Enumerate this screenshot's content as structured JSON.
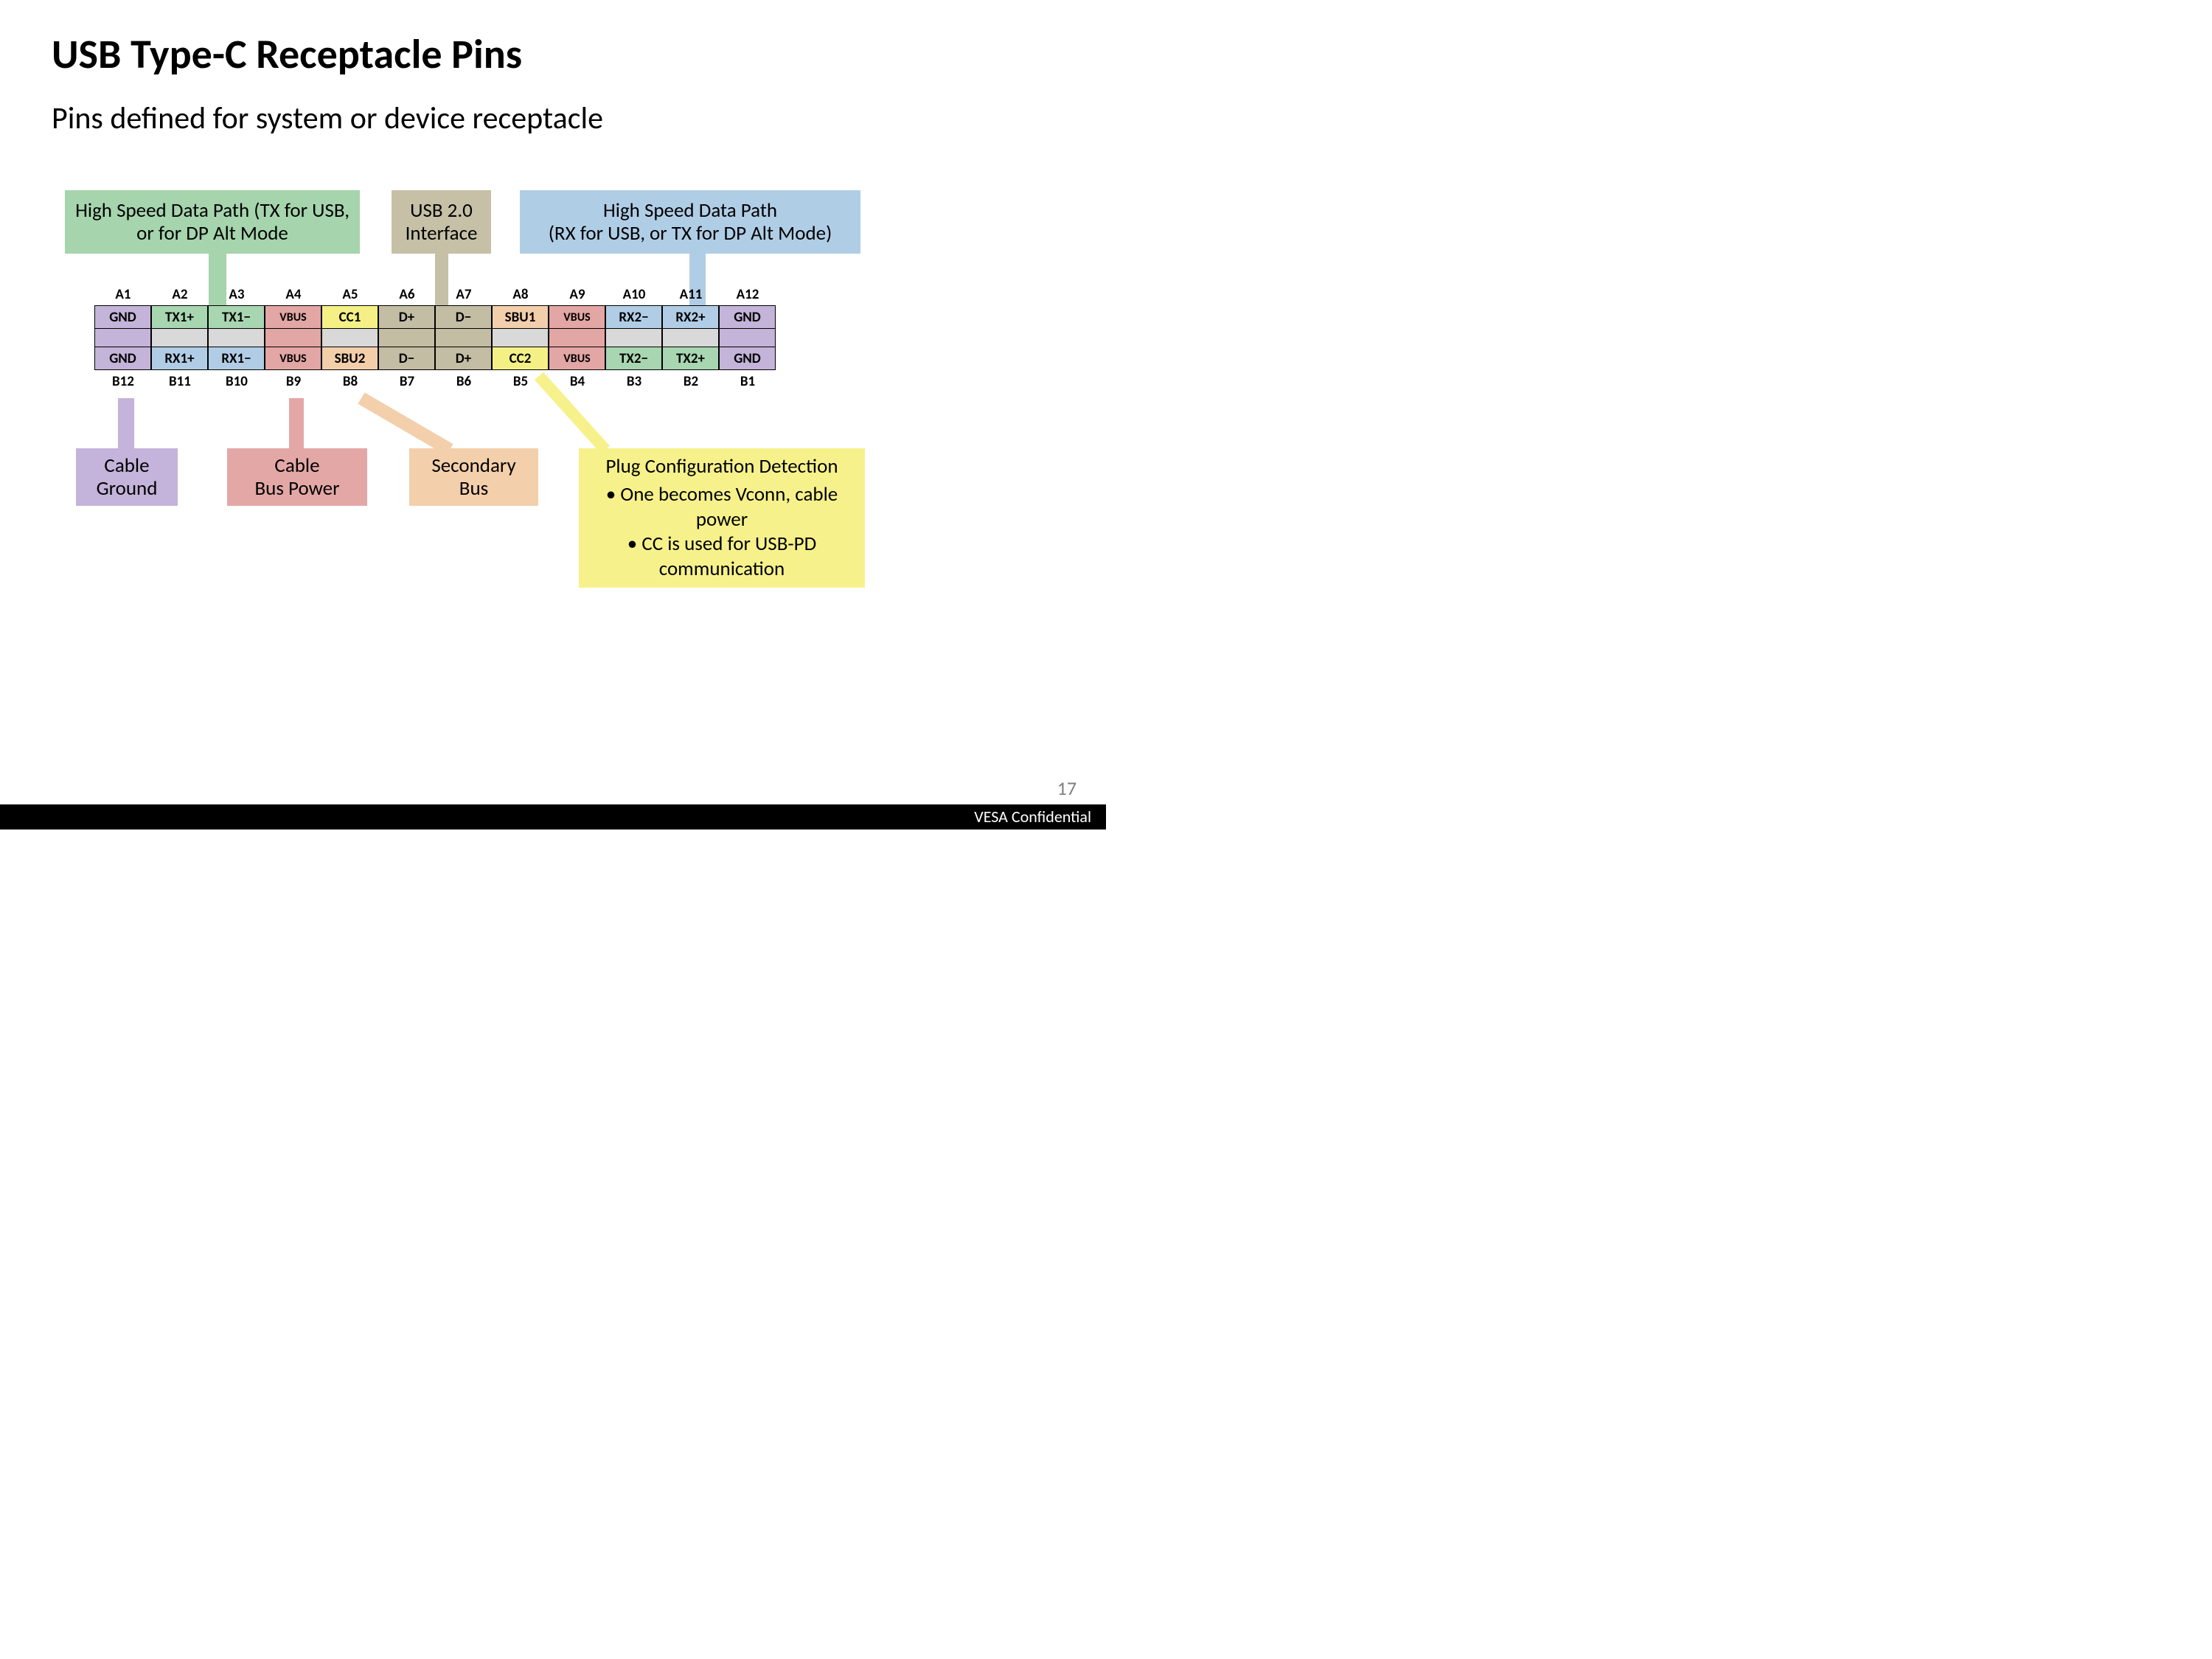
{
  "title": "USB Type-C Receptacle Pins",
  "subtitle": "Pins defined for system or device receptacle",
  "pageNumber": "17",
  "watermark": "VESA Confidential",
  "colors": {
    "gnd": "#c4b4d9",
    "txgreen": "#a8d6b1",
    "vbus": "#e2a6a4",
    "cc": "#f4f086",
    "usb2": "#c2bda3",
    "sbu": "#f2ceab",
    "rxblue": "#b1cde6",
    "midGrey": "#d9d9d9",
    "calloutGreen": "#a5d4ad",
    "calloutTan": "#c5c0a6",
    "calloutBlue": "#b0cde6",
    "calloutPurple": "#c4b3da",
    "calloutRed": "#e3a8a6",
    "calloutOrange": "#f3cfab",
    "calloutYellow": "#f6f18b"
  },
  "callouts": {
    "hsTx": "High Speed Data Path (TX for USB, or for DP Alt Mode",
    "usb2": "USB 2.0 Interface",
    "hsRx": "High Speed Data Path\n(RX for USB, or TX for DP Alt Mode)",
    "cableGround": "Cable Ground",
    "cableBusPower": "Cable\nBus Power",
    "secondaryBus": "Secondary Bus",
    "plugTitle": "Plug Configuration Detection",
    "plugBullet1": "One becomes Vconn, cable power",
    "plugBullet2": "CC is used for USB-PD communication"
  },
  "labelsTop": [
    "A1",
    "A2",
    "A3",
    "A4",
    "A5",
    "A6",
    "A7",
    "A8",
    "A9",
    "A10",
    "A11",
    "A12"
  ],
  "labelsBottom": [
    "B12",
    "B11",
    "B10",
    "B9",
    "B8",
    "B7",
    "B6",
    "B5",
    "B4",
    "B3",
    "B2",
    "B1"
  ],
  "rowA": [
    {
      "text": "GND",
      "c": "gnd"
    },
    {
      "text": "TX1+",
      "c": "txgreen"
    },
    {
      "text": "TX1−",
      "c": "txgreen"
    },
    {
      "text": "VBUS",
      "c": "vbus",
      "small": true
    },
    {
      "text": "CC1",
      "c": "cc"
    },
    {
      "text": "D+",
      "c": "usb2"
    },
    {
      "text": "D−",
      "c": "usb2"
    },
    {
      "text": "SBU1",
      "c": "sbu"
    },
    {
      "text": "VBUS",
      "c": "vbus",
      "small": true
    },
    {
      "text": "RX2−",
      "c": "rxblue"
    },
    {
      "text": "RX2+",
      "c": "rxblue"
    },
    {
      "text": "GND",
      "c": "gnd"
    }
  ],
  "rowB": [
    {
      "text": "GND",
      "c": "gnd"
    },
    {
      "text": "RX1+",
      "c": "rxblue"
    },
    {
      "text": "RX1−",
      "c": "rxblue"
    },
    {
      "text": "VBUS",
      "c": "vbus",
      "small": true
    },
    {
      "text": "SBU2",
      "c": "sbu"
    },
    {
      "text": "D−",
      "c": "usb2"
    },
    {
      "text": "D+",
      "c": "usb2"
    },
    {
      "text": "CC2",
      "c": "cc"
    },
    {
      "text": "VBUS",
      "c": "vbus",
      "small": true
    },
    {
      "text": "TX2−",
      "c": "txgreen"
    },
    {
      "text": "TX2+",
      "c": "txgreen"
    },
    {
      "text": "GND",
      "c": "gnd"
    }
  ],
  "midRow": [
    {
      "c": "gnd"
    },
    {
      "c": "midGrey"
    },
    {
      "c": "midGrey"
    },
    {
      "c": "vbus"
    },
    {
      "c": "midGrey"
    },
    {
      "c": "usb2"
    },
    {
      "c": "usb2"
    },
    {
      "c": "midGrey"
    },
    {
      "c": "vbus"
    },
    {
      "c": "midGrey"
    },
    {
      "c": "midGrey"
    },
    {
      "c": "gnd"
    }
  ],
  "chart_data": {
    "type": "table",
    "title": "USB Type-C Receptacle Pinout",
    "columns_top": [
      "A1",
      "A2",
      "A3",
      "A4",
      "A5",
      "A6",
      "A7",
      "A8",
      "A9",
      "A10",
      "A11",
      "A12"
    ],
    "row_top": [
      "GND",
      "TX1+",
      "TX1−",
      "VBUS",
      "CC1",
      "D+",
      "D−",
      "SBU1",
      "VBUS",
      "RX2−",
      "RX2+",
      "GND"
    ],
    "columns_bot": [
      "B12",
      "B11",
      "B10",
      "B9",
      "B8",
      "B7",
      "B6",
      "B5",
      "B4",
      "B3",
      "B2",
      "B1"
    ],
    "row_bot": [
      "GND",
      "RX1+",
      "RX1−",
      "VBUS",
      "SBU2",
      "D−",
      "D+",
      "CC2",
      "VBUS",
      "TX2−",
      "TX2+",
      "GND"
    ],
    "color_legend": {
      "GND": "Cable Ground",
      "TX": "High Speed Data Path (TX for USB, or for DP Alt Mode)",
      "RX": "High Speed Data Path (RX for USB, or TX for DP Alt Mode)",
      "VBUS": "Cable Bus Power",
      "CC": "Plug Configuration Detection / Vconn / USB-PD",
      "D": "USB 2.0 Interface",
      "SBU": "Secondary Bus"
    }
  }
}
